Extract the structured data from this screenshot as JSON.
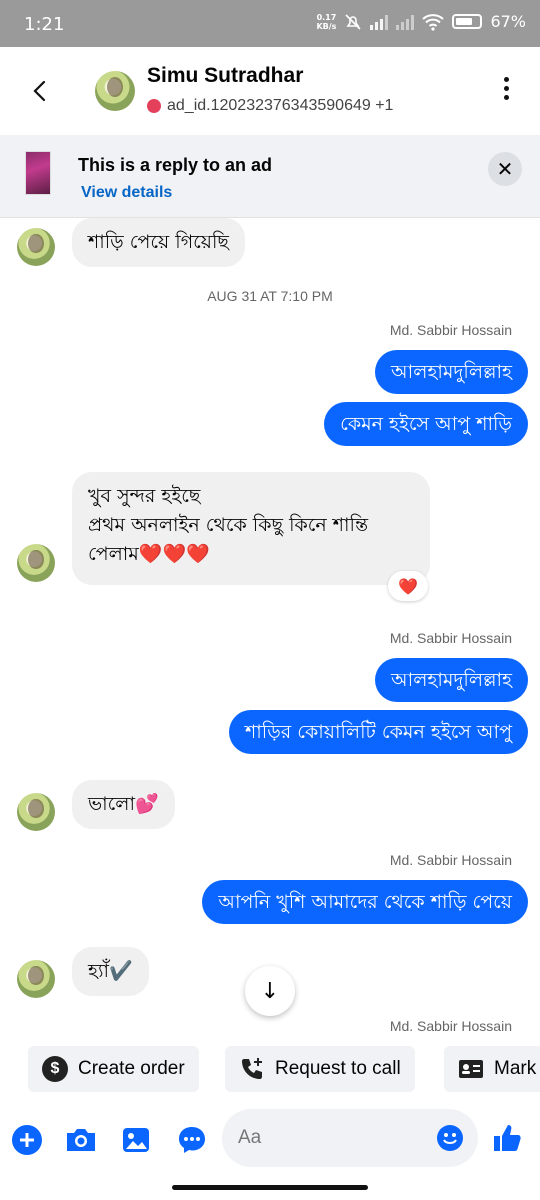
{
  "status": {
    "time": "1:21",
    "speed_value": "0.17",
    "speed_unit": "KB/s",
    "battery": "67%"
  },
  "header": {
    "name": "Simu Sutradhar",
    "subtitle": "ad_id.120232376343590649 +1"
  },
  "ad_banner": {
    "title": "This is a reply to an ad",
    "link": "View details"
  },
  "timestamp": "AUG 31 AT 7:10 PM",
  "sender_name": "Md. Sabbir Hossain",
  "messages": {
    "in_1": "শাড়ি পেয়ে গিয়েছি",
    "out_1": "আলহামদুলিল্লাহ",
    "out_2": "কেমন হইসে আপু শাড়ি",
    "in_2_line1": "খুব সুন্দর হইছে",
    "in_2_line2": "প্রথম অনলাইন থেকে কিছু কিনে শান্তি",
    "in_2_line3": "পেলাম❤️❤️❤️",
    "reaction": "❤️",
    "out_3": "আলহামদুলিল্লাহ",
    "out_4": "শাড়ির কোয়ালিটি কেমন হইসে আপু",
    "in_3": "ভালো💕",
    "out_5": "আপনি খুশি আমাদের থেকে শাড়ি পেয়ে",
    "in_4": "হ্যাঁ✔️"
  },
  "quick_actions": {
    "create_order": "Create order",
    "request_call": "Request to call",
    "mark": "Mark"
  },
  "composer": {
    "placeholder": "Aa"
  },
  "colors": {
    "accent": "#0a66ff",
    "incoming_bubble": "#f0f0f0",
    "link": "#0866c6"
  }
}
